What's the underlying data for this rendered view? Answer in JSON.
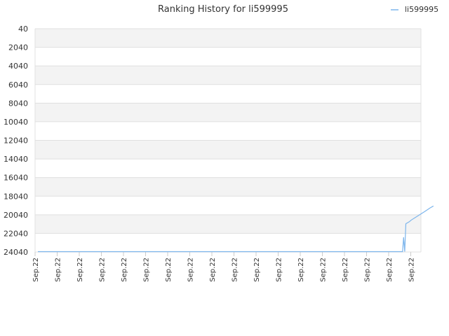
{
  "chart_data": {
    "type": "line",
    "title": "Ranking History for li599995",
    "legend": {
      "entries": [
        "li599995"
      ],
      "placement": "top-right"
    },
    "y_axis": {
      "inverted": true,
      "ylim": [
        40,
        24040
      ],
      "ticks": [
        40,
        2040,
        4040,
        6040,
        8040,
        10040,
        12040,
        14040,
        16040,
        18040,
        20040,
        22040,
        24040
      ],
      "tick_labels": [
        "40",
        "2040",
        "4040",
        "6040",
        "8040",
        "10040",
        "12040",
        "14040",
        "16040",
        "18040",
        "20040",
        "22040",
        "24040"
      ]
    },
    "x_axis": {
      "tick_labels": [
        "Sep.22",
        "Sep.22",
        "Sep.22",
        "Sep.22",
        "Sep.22",
        "Sep.22",
        "Sep.22",
        "Sep.22",
        "Sep.22",
        "Sep.22",
        "Sep.22",
        "Sep.22",
        "Sep.22",
        "Sep.22",
        "Sep.22",
        "Sep.22",
        "Sep.22",
        "Sep.22"
      ]
    },
    "grid": {
      "horizontal": true,
      "alternating_bands": true
    },
    "series": [
      {
        "name": "li599995",
        "color": "#7cb5ec",
        "points": [
          {
            "x": 0.0,
            "y": 24040
          },
          {
            "x": 16.5,
            "y": 24040
          },
          {
            "x": 16.55,
            "y": 22450
          },
          {
            "x": 16.6,
            "y": 24000
          },
          {
            "x": 16.65,
            "y": 21000
          },
          {
            "x": 16.8,
            "y": 20800
          },
          {
            "x": 16.9,
            "y": 20600
          },
          {
            "x": 17.1,
            "y": 20300
          },
          {
            "x": 17.3,
            "y": 20000
          },
          {
            "x": 17.5,
            "y": 19700
          },
          {
            "x": 17.75,
            "y": 19300
          },
          {
            "x": 17.9,
            "y": 19100
          }
        ]
      }
    ]
  }
}
